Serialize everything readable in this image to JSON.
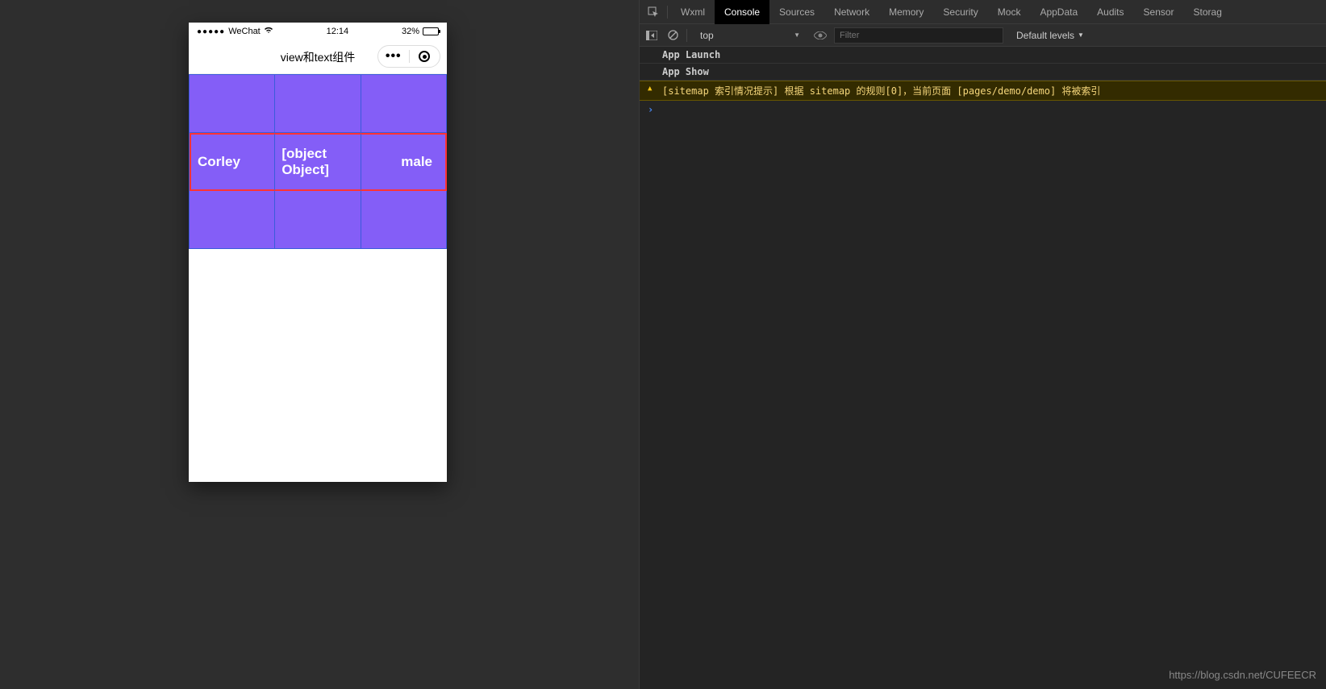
{
  "phone": {
    "status": {
      "carrier": "WeChat",
      "time": "12:14",
      "battery_pct": "32%"
    },
    "nav_title": "view和text组件",
    "grid": {
      "row1": [
        "",
        "",
        ""
      ],
      "row2": [
        "Corley",
        "[object Object]",
        "male"
      ],
      "row3": [
        "",
        "",
        ""
      ]
    }
  },
  "devtools": {
    "tabs": [
      "Wxml",
      "Console",
      "Sources",
      "Network",
      "Memory",
      "Security",
      "Mock",
      "AppData",
      "Audits",
      "Sensor",
      "Storag"
    ],
    "active_tab": "Console",
    "toolbar": {
      "context": "top",
      "filter_placeholder": "Filter",
      "levels": "Default levels"
    },
    "console": {
      "lines": [
        {
          "type": "log",
          "text": "App Launch"
        },
        {
          "type": "log",
          "text": "App Show"
        },
        {
          "type": "warn",
          "text": "[sitemap 索引情况提示] 根据 sitemap 的规则[0]，当前页面 [pages/demo/demo] 将被索引"
        }
      ],
      "prompt": "›"
    }
  },
  "watermark": "https://blog.csdn.net/CUFEECR"
}
